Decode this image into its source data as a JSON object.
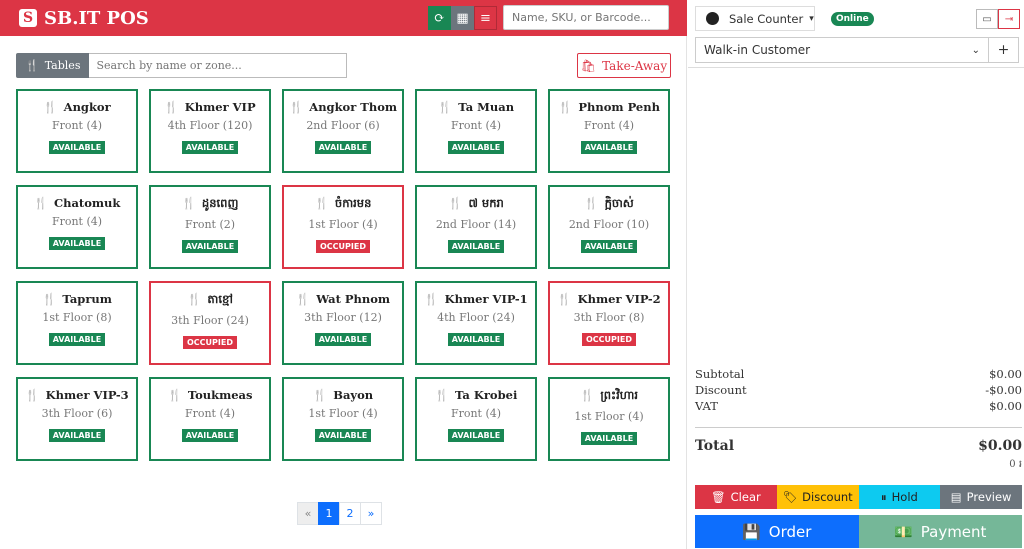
{
  "header": {
    "brand_icon": "S",
    "brand": "SB.IT POS",
    "search_placeholder": "Name, SKU, or Barcode...",
    "colors": {
      "bar": "#dc3545"
    }
  },
  "filter": {
    "tables_label": "Tables",
    "search_placeholder": "Search by name or zone...",
    "takeaway_label": "Take-Away"
  },
  "tables": [
    {
      "name": "Angkor",
      "floor": "Front (4)",
      "status": "AVAILABLE"
    },
    {
      "name": "Khmer VIP",
      "floor": "4th Floor (120)",
      "status": "AVAILABLE"
    },
    {
      "name": "Angkor Thom",
      "floor": "2nd Floor (6)",
      "status": "AVAILABLE"
    },
    {
      "name": "Ta Muan",
      "floor": "Front (4)",
      "status": "AVAILABLE"
    },
    {
      "name": "Phnom Penh",
      "floor": "Front (4)",
      "status": "AVAILABLE"
    },
    {
      "name": "Chatomuk",
      "floor": "Front (4)",
      "status": "AVAILABLE"
    },
    {
      "name": "ដូនពេញ",
      "floor": "Front (2)",
      "status": "AVAILABLE"
    },
    {
      "name": "ចំការមន",
      "floor": "1st Floor (4)",
      "status": "OCCUPIED"
    },
    {
      "name": "៧ មករា",
      "floor": "2nd Floor (14)",
      "status": "AVAILABLE"
    },
    {
      "name": "ក្អិចាស់",
      "floor": "2nd Floor (10)",
      "status": "AVAILABLE"
    },
    {
      "name": "Taprum",
      "floor": "1st Floor (8)",
      "status": "AVAILABLE"
    },
    {
      "name": "តាខ្មៅ",
      "floor": "3th Floor (24)",
      "status": "OCCUPIED"
    },
    {
      "name": "Wat Phnom",
      "floor": "3th Floor (12)",
      "status": "AVAILABLE"
    },
    {
      "name": "Khmer VIP-1",
      "floor": "4th Floor (24)",
      "status": "AVAILABLE"
    },
    {
      "name": "Khmer VIP-2",
      "floor": "3th Floor (8)",
      "status": "OCCUPIED"
    },
    {
      "name": "Khmer VIP-3",
      "floor": "3th Floor (6)",
      "status": "AVAILABLE"
    },
    {
      "name": "Toukmeas",
      "floor": "Front (4)",
      "status": "AVAILABLE"
    },
    {
      "name": "Bayon",
      "floor": "1st Floor (4)",
      "status": "AVAILABLE"
    },
    {
      "name": "Ta Krobei",
      "floor": "Front (4)",
      "status": "AVAILABLE"
    },
    {
      "name": "ព្រះវិហារ",
      "floor": "1st Floor (4)",
      "status": "AVAILABLE"
    }
  ],
  "pagination": {
    "prev": "«",
    "pages": [
      "1",
      "2"
    ],
    "next": "»",
    "current": "1"
  },
  "cart": {
    "counter_label": "Sale Counter",
    "status": "Online",
    "customer": "Walk-in Customer",
    "add_symbol": "+",
    "subtotal_label": "Subtotal",
    "subtotal": "$0.00",
    "discount_label": "Discount",
    "discount": "-$0.00",
    "vat_label": "VAT",
    "vat": "$0.00",
    "total_label": "Total",
    "total": "$0.00",
    "total_riel": "0 ៛"
  },
  "actions": {
    "clear": "Clear",
    "discount": "Discount",
    "hold": "Hold",
    "preview": "Preview",
    "order": "Order",
    "payment": "Payment"
  }
}
